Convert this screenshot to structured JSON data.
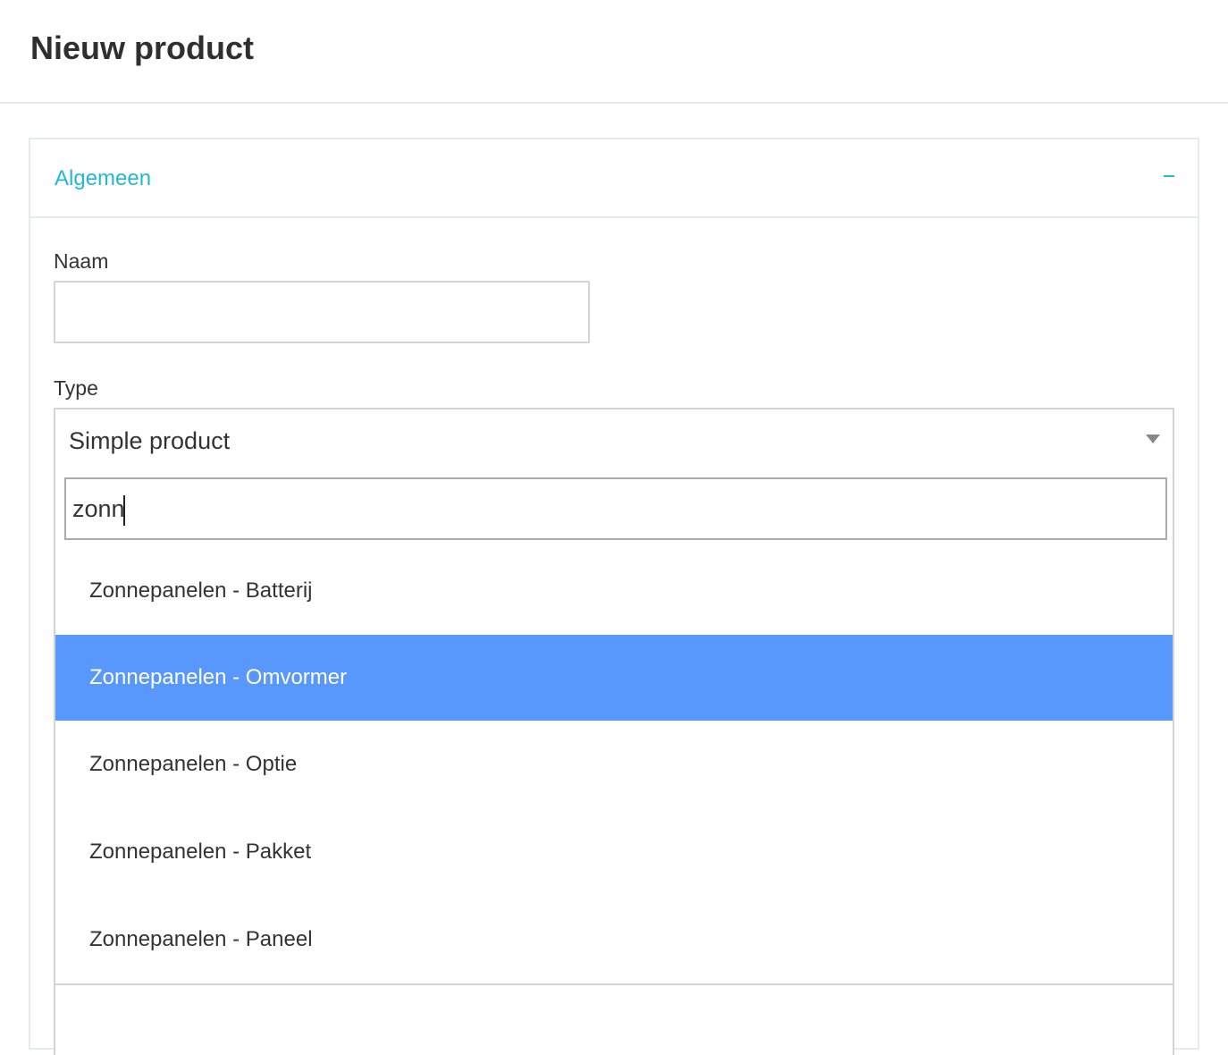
{
  "page": {
    "title": "Nieuw product"
  },
  "panel": {
    "title": "Algemeen",
    "collapse_icon": "minus-icon",
    "accent_color": "#23b7d8"
  },
  "form": {
    "naam": {
      "label": "Naam",
      "value": ""
    },
    "type": {
      "label": "Type",
      "selected": "Simple product",
      "search_value": "zonn",
      "options": [
        {
          "label": "Zonnepanelen - Batterij",
          "highlighted": false
        },
        {
          "label": "Zonnepanelen - Omvormer",
          "highlighted": true
        },
        {
          "label": "Zonnepanelen - Optie",
          "highlighted": false
        },
        {
          "label": "Zonnepanelen - Pakket",
          "highlighted": false
        },
        {
          "label": "Zonnepanelen - Paneel",
          "highlighted": false
        }
      ],
      "highlight_color": "#5897fb"
    }
  }
}
